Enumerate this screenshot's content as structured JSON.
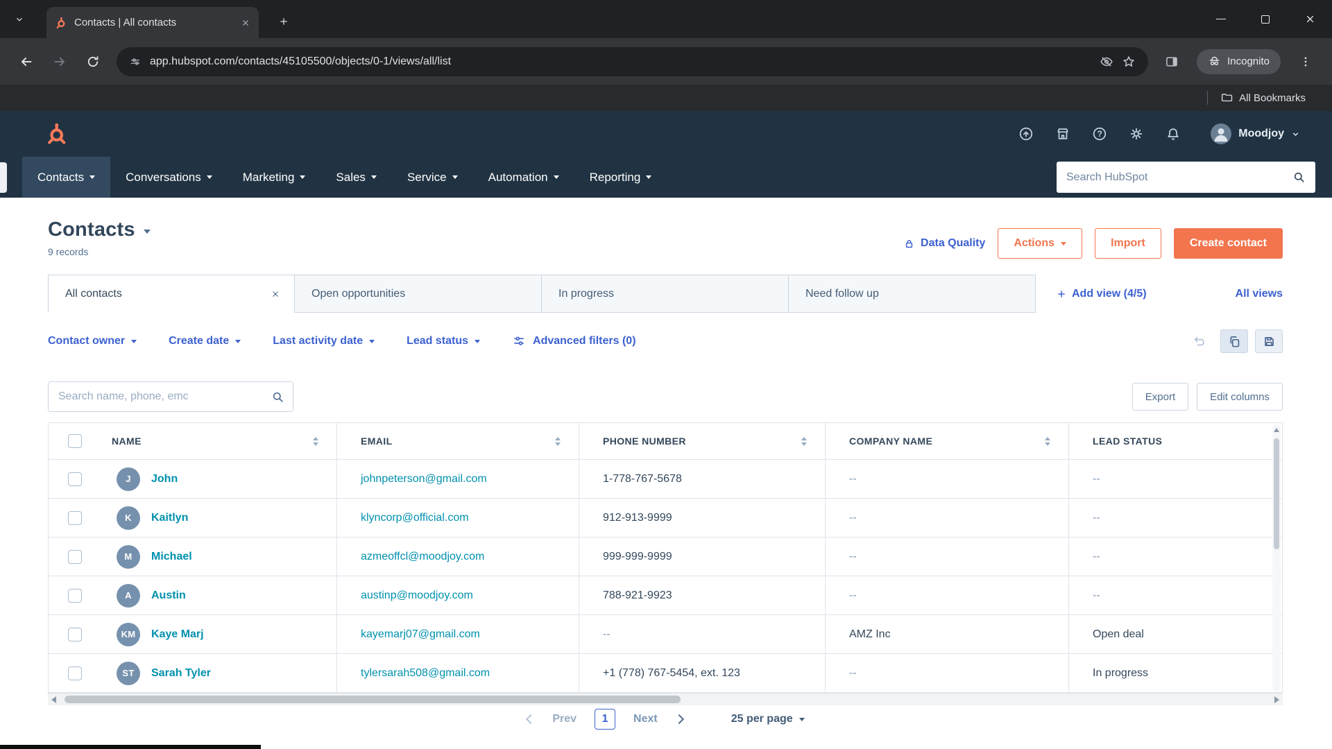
{
  "colors": {
    "navy": "#213343",
    "accent_orange": "#f2754e",
    "link_blue": "#3c61d0",
    "link_teal": "#0091ae",
    "avatar_blue": "#7691ad"
  },
  "browser": {
    "tab_title": "Contacts | All contacts",
    "url": "app.hubspot.com/contacts/45105500/objects/0-1/views/all/list",
    "incognito_label": "Incognito",
    "bookmarks_label": "All Bookmarks"
  },
  "topbar": {
    "account_name": "Moodjoy"
  },
  "nav": {
    "items": [
      {
        "label": "Contacts",
        "active": true
      },
      {
        "label": "Conversations"
      },
      {
        "label": "Marketing"
      },
      {
        "label": "Sales"
      },
      {
        "label": "Service"
      },
      {
        "label": "Automation"
      },
      {
        "label": "Reporting"
      }
    ],
    "search_placeholder": "Search HubSpot"
  },
  "page": {
    "title": "Contacts",
    "record_count": "9 records",
    "data_quality_label": "Data Quality",
    "actions_label": "Actions",
    "import_label": "Import",
    "create_contact_label": "Create contact"
  },
  "views": {
    "tabs": [
      {
        "label": "All contacts",
        "active": true
      },
      {
        "label": "Open opportunities"
      },
      {
        "label": "In progress"
      },
      {
        "label": "Need follow up"
      }
    ],
    "add_view_label": "Add view (4/5)",
    "all_views_label": "All views"
  },
  "filters": {
    "dropdowns": [
      "Contact owner",
      "Create date",
      "Last activity date",
      "Lead status"
    ],
    "advanced_label": "Advanced filters (0)"
  },
  "list_toolbar": {
    "search_placeholder": "Search name, phone, emc",
    "export_label": "Export",
    "edit_columns_label": "Edit columns"
  },
  "table": {
    "columns": [
      "NAME",
      "EMAIL",
      "PHONE NUMBER",
      "COMPANY NAME",
      "LEAD STATUS"
    ],
    "rows": [
      {
        "initials": "J",
        "name": "John",
        "email": "johnpeterson@gmail.com",
        "phone": "1-778-767-5678",
        "company": "--",
        "lead_status": "--"
      },
      {
        "initials": "K",
        "name": "Kaitlyn",
        "email": "klyncorp@official.com",
        "phone": "912-913-9999",
        "company": "--",
        "lead_status": "--"
      },
      {
        "initials": "M",
        "name": "Michael",
        "email": "azmeoffcl@moodjoy.com",
        "phone": "999-999-9999",
        "company": "--",
        "lead_status": "--"
      },
      {
        "initials": "A",
        "name": "Austin",
        "email": "austinp@moodjoy.com",
        "phone": "788-921-9923",
        "company": "--",
        "lead_status": "--"
      },
      {
        "initials": "KM",
        "name": "Kaye Marj",
        "email": "kayemarj07@gmail.com",
        "phone": "--",
        "company": "AMZ Inc",
        "lead_status": "Open deal"
      },
      {
        "initials": "ST",
        "name": "Sarah Tyler",
        "email": "tylersarah508@gmail.com",
        "phone": "+1 (778) 767-5454, ext. 123",
        "company": "--",
        "lead_status": "In progress"
      }
    ]
  },
  "pagination": {
    "prev_label": "Prev",
    "current_page": "1",
    "next_label": "Next",
    "per_page_label": "25 per page"
  }
}
